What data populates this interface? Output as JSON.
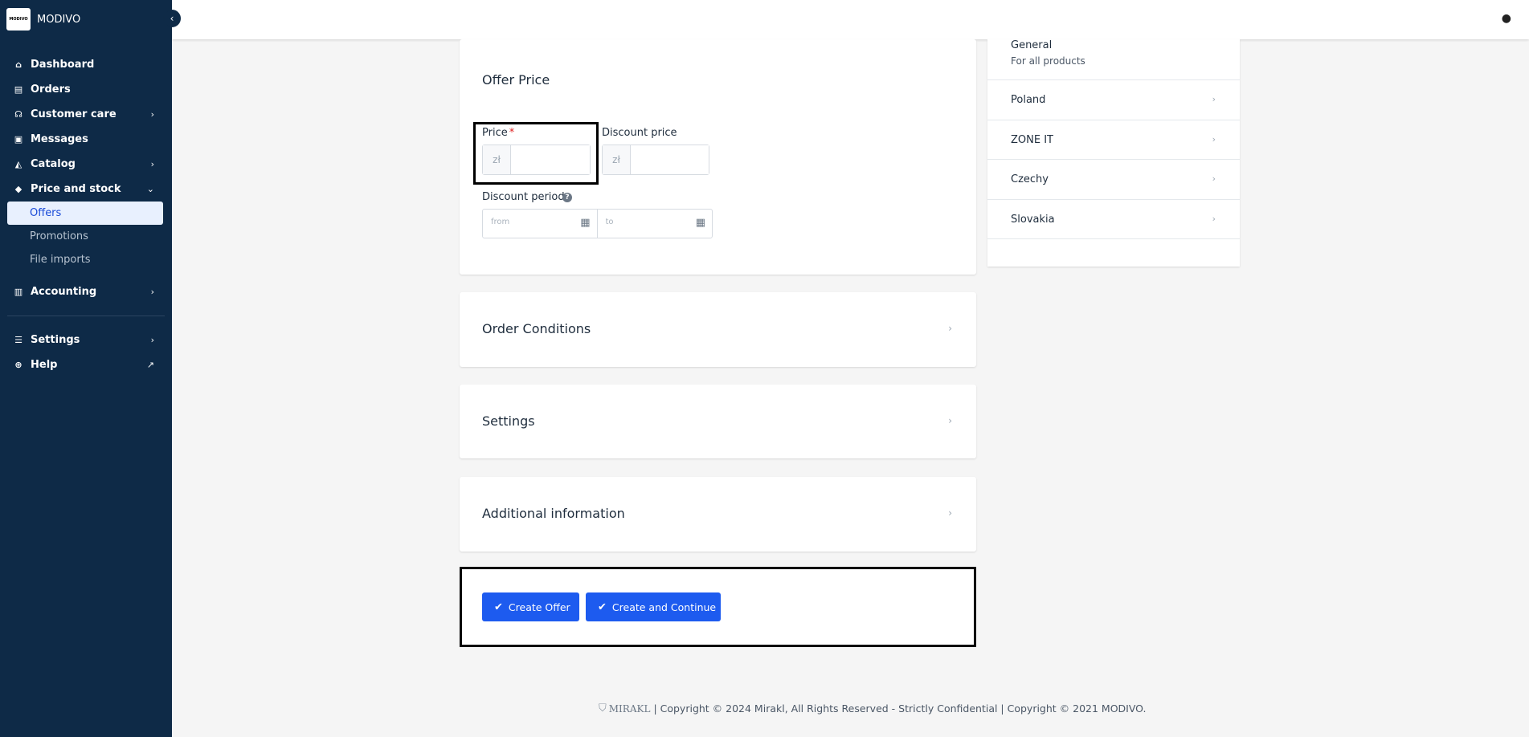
{
  "brand": {
    "logo_text": "MODIVO",
    "name": "MODIVO"
  },
  "sidebar": {
    "collapse_icon": "‹",
    "items": [
      {
        "label": "Dashboard",
        "icon": "⌂"
      },
      {
        "label": "Orders",
        "icon": "▤"
      },
      {
        "label": "Customer care",
        "icon": "☊",
        "chevron": "›"
      },
      {
        "label": "Messages",
        "icon": "▣"
      },
      {
        "label": "Catalog",
        "icon": "◭",
        "chevron": "›"
      },
      {
        "label": "Price and stock",
        "icon": "◆",
        "chevron": "⌄"
      }
    ],
    "sub_items": [
      {
        "label": "Offers"
      },
      {
        "label": "Promotions"
      },
      {
        "label": "File imports"
      }
    ],
    "accounting": {
      "label": "Accounting",
      "icon": "▥",
      "chevron": "›"
    },
    "bottom": [
      {
        "label": "Settings",
        "icon": "☰",
        "chevron": "›"
      },
      {
        "label": "Help",
        "icon": "⊕",
        "chevron": "↗"
      }
    ]
  },
  "topbar": {
    "user_icon": "●"
  },
  "offer_price": {
    "title": "Offer Price",
    "price_label": "Price",
    "required_mark": "*",
    "currency": "zł",
    "discount_price_label": "Discount price",
    "discount_period_label": "Discount period",
    "help_icon": "?",
    "from_placeholder": "from",
    "to_placeholder": "to",
    "calendar_icon": "▦"
  },
  "sections": [
    {
      "title": "Order Conditions"
    },
    {
      "title": "Settings"
    },
    {
      "title": "Additional information"
    }
  ],
  "chevron_right": "›",
  "actions": {
    "create_offer": "Create Offer",
    "create_continue": "Create and Continue",
    "check_icon": "✔"
  },
  "zones": {
    "general_title": "General",
    "general_sub": "For all products",
    "list": [
      "Poland",
      "ZONE IT",
      "Czechy",
      "Slovakia"
    ]
  },
  "footer": {
    "brand": "MIRAKL",
    "text": "| Copyright © 2024 Mirakl, All Rights Reserved - Strictly Confidential | Copyright © 2021 MODIVO."
  }
}
